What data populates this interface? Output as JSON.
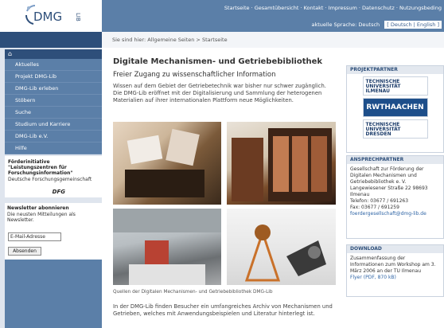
{
  "header": {
    "logo_text": "DMG",
    "logo_sub": "LIB",
    "top_links": "Startseite · Gesamtübersicht · Kontakt · Impressum · Datenschutz · Nutzungsbeding",
    "language_label": "aktuelle Sprache: Deutsch",
    "language_links": "[ Deutsch | English ]"
  },
  "breadcrumb": {
    "prefix": "Sie sind hier:",
    "path": "Allgemeine Seiten  >  Startseite"
  },
  "nav": {
    "home_icon": "⌂",
    "items": [
      {
        "label": "Aktuelles"
      },
      {
        "label": "Projekt DMG-Lib"
      },
      {
        "label": "DMG-Lib erleben"
      },
      {
        "label": "Stöbern"
      },
      {
        "label": "Suche"
      },
      {
        "label": "Studium und Karriere"
      },
      {
        "label": "DMG-Lib e.V."
      },
      {
        "label": "Hilfe"
      }
    ]
  },
  "funding": {
    "title": "Förderinitiative \"Leistungszentren für Forschungsinformation\"",
    "org": "Deutsche Forschungsgemeinschaft",
    "logo_text": "DFG"
  },
  "newsletter": {
    "title": "Newsletter abonnieren",
    "text": "Die neusten Mitteilungen als Newsletter.",
    "input_value": "E-Mail-Adresse",
    "button_label": "Absenden"
  },
  "main": {
    "title": "Digitale Mechanismen- und Getriebebibliothek",
    "subtitle": "Freier Zugang zu wissenschaftlicher Information",
    "intro": "Wissen auf dem Gebiet der Getriebetechnik war bisher nur schwer zugänglich. Die DMG-Lib eröffnet mit der Digitalisierung und Sammlung der heterogenen Materialien auf ihrer internationalen Plattform neue Möglichkeiten.",
    "caption": "Quellen der Digitalen Mechanismen- und Getriebebibliothek DMG-Lib",
    "outro": "In der DMG-Lib finden Besucher ein umfangreiches Archiv von Mechanismen und Getrieben, welches mit Anwendungsbeispielen und Literatur hinterlegt ist."
  },
  "partners": {
    "heading": "PROJEKTPARTNER",
    "items": [
      {
        "label": "TECHNISCHE UNIVERSITÄT ILMENAU"
      },
      {
        "label": "RWTHAACHEN"
      },
      {
        "label": "TECHNISCHE UNIVERSITÄT DRESDEN"
      }
    ]
  },
  "contact": {
    "heading": "ANSPRECHPARTNER",
    "body": "Gesellschaft zur Förderung der Digitalen Mechanismen und Getriebebibliothek e. V. Langewiesener Straße 22 98693 Ilmenau",
    "phone": "Telefon: 03677 / 691263",
    "fax": "Fax: 03677 / 691259",
    "email": "foerdergesellschaft@dmg-lib.de"
  },
  "download": {
    "heading": "DOWNLOAD",
    "body": "Zusammenfassung der Informationen zum Workshop am 3. März 2006 an der TU Ilmenau",
    "link": "Flyer (PDF, 870 kB)"
  },
  "colors": {
    "nav_blue": "#5b7fa8",
    "dark_blue": "#2e4f7a",
    "pale_blue": "#dfe5ee"
  }
}
